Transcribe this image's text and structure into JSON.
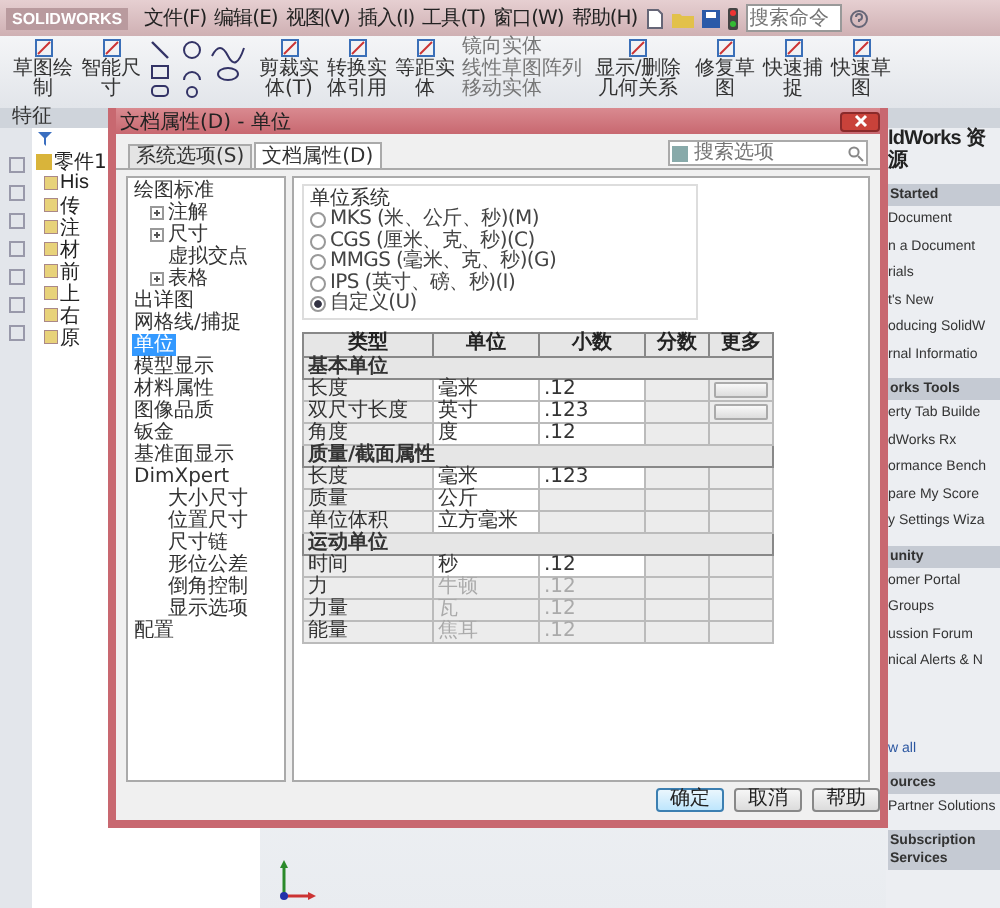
{
  "app": {
    "logo": "SOLIDWORKS",
    "menu": [
      "文件(F)",
      "编辑(E)",
      "视图(V)",
      "插入(I)",
      "工具(T)",
      "窗口(W)",
      "帮助(H)"
    ],
    "search": {
      "placeholder": "搜索命令"
    },
    "ribbon": [
      {
        "label": "草图绘制",
        "kind": "button"
      },
      {
        "label": "智能尺寸",
        "kind": "button"
      },
      {
        "kind": "tools"
      },
      {
        "label": "剪裁实体(T)",
        "kind": "button"
      },
      {
        "label": "转换实体引用",
        "kind": "button"
      },
      {
        "label": "等距实体",
        "kind": "button"
      },
      {
        "kind": "list",
        "items": [
          "镜向实体",
          "线性草图阵列",
          "移动实体"
        ]
      },
      {
        "label": "显示/删除几何关系",
        "kind": "wide"
      },
      {
        "label": "修复草图",
        "kind": "button"
      },
      {
        "label": "快速捕捉",
        "kind": "button"
      },
      {
        "label": "快速草图",
        "kind": "button"
      }
    ],
    "tabs": [
      {
        "label": "特征",
        "selected": false
      }
    ]
  },
  "feature_tree": {
    "root": "零件1",
    "items": [
      "His",
      "传",
      "注",
      "材",
      "前",
      "上",
      "右",
      "原"
    ]
  },
  "dialog": {
    "title": "文档属性(D) - 单位",
    "tabs": [
      {
        "label": "系统选项(S)",
        "selected": false
      },
      {
        "label": "文档属性(D)",
        "selected": true
      }
    ],
    "search": {
      "placeholder": "搜索选项"
    },
    "tree": [
      {
        "label": "绘图标准",
        "selected": false,
        "expanded": true,
        "children": [
          {
            "label": "注解",
            "selected": false,
            "expanded": false
          },
          {
            "label": "尺寸",
            "selected": false,
            "expanded": false
          },
          {
            "label": "虚拟交点",
            "selected": false
          },
          {
            "label": "表格",
            "selected": false,
            "expanded": false
          }
        ]
      },
      {
        "label": "出详图",
        "selected": false
      },
      {
        "label": "网格线/捕捉",
        "selected": false
      },
      {
        "label": "单位",
        "selected": true
      },
      {
        "label": "模型显示",
        "selected": false
      },
      {
        "label": "材料属性",
        "selected": false
      },
      {
        "label": "图像品质",
        "selected": false
      },
      {
        "label": "钣金",
        "selected": false
      },
      {
        "label": "基准面显示",
        "selected": false
      },
      {
        "label": "DimXpert",
        "selected": false,
        "expanded": true,
        "children": [
          {
            "label": "大小尺寸",
            "selected": false
          },
          {
            "label": "位置尺寸",
            "selected": false
          },
          {
            "label": "尺寸链",
            "selected": false
          },
          {
            "label": "形位公差",
            "selected": false
          },
          {
            "label": "倒角控制",
            "selected": false
          },
          {
            "label": "显示选项",
            "selected": false
          }
        ]
      },
      {
        "label": "配置",
        "selected": false
      }
    ],
    "unit_system": {
      "title": "单位系统",
      "options": [
        {
          "label": "MKS (米、公斤、秒)(M)",
          "selected": false
        },
        {
          "label": "CGS (厘米、克、秒)(C)",
          "selected": false
        },
        {
          "label": "MMGS (毫米、克、秒)(G)",
          "selected": false
        },
        {
          "label": "IPS (英寸、磅、秒)(I)",
          "selected": false
        },
        {
          "label": "自定义(U)",
          "selected": true
        }
      ]
    },
    "table": {
      "columns": [
        "类型",
        "单位",
        "小数",
        "分数",
        "更多"
      ],
      "rows": [
        {
          "kind": "section",
          "label": "基本单位"
        },
        {
          "kind": "row",
          "type": "长度",
          "unit": "毫米",
          "decimal": ".12",
          "disabled": false,
          "more": true
        },
        {
          "kind": "row",
          "type": "双尺寸长度",
          "unit": "英寸",
          "decimal": ".123",
          "disabled": false,
          "more": true
        },
        {
          "kind": "row",
          "type": "角度",
          "unit": "度",
          "decimal": ".12",
          "disabled": false,
          "more": false
        },
        {
          "kind": "section",
          "label": "质量/截面属性"
        },
        {
          "kind": "row",
          "type": "长度",
          "unit": "毫米",
          "decimal": ".123",
          "disabled": false,
          "more": false
        },
        {
          "kind": "row",
          "type": "质量",
          "unit": "公斤",
          "disabled": false,
          "more": false
        },
        {
          "kind": "row",
          "type": "单位体积",
          "unit": "立方毫米",
          "disabled": false,
          "more": false
        },
        {
          "kind": "section",
          "label": "运动单位"
        },
        {
          "kind": "row",
          "type": "时间",
          "unit": "秒",
          "decimal": ".12",
          "disabled": false,
          "more": false
        },
        {
          "kind": "row",
          "type": "力",
          "unit": "牛顿",
          "decimal": ".12",
          "disabled": true,
          "more": false
        },
        {
          "kind": "row",
          "type": "力量",
          "unit": "瓦",
          "decimal": ".12",
          "disabled": true,
          "more": false
        },
        {
          "kind": "row",
          "type": "能量",
          "unit": "焦耳",
          "decimal": ".12",
          "disabled": true,
          "more": false
        }
      ]
    },
    "buttons": [
      {
        "label": "确定",
        "kind": "default"
      },
      {
        "label": "取消",
        "kind": "normal"
      },
      {
        "label": "帮助",
        "kind": "normal"
      }
    ]
  },
  "task_pane": {
    "title": "ldWorks 资源",
    "items": [
      {
        "kind": "header",
        "text": "Started"
      },
      {
        "kind": "item",
        "text": "Document"
      },
      {
        "kind": "item",
        "text": "n a Document"
      },
      {
        "kind": "item",
        "text": "rials"
      },
      {
        "kind": "item",
        "text": "t's New"
      },
      {
        "kind": "item",
        "text": "oducing SolidW"
      },
      {
        "kind": "item",
        "text": "rnal Informatio"
      },
      {
        "kind": "header",
        "text": "orks Tools"
      },
      {
        "kind": "item",
        "text": "erty Tab Builde"
      },
      {
        "kind": "item",
        "text": "dWorks Rx"
      },
      {
        "kind": "item",
        "text": "ormance Bench"
      },
      {
        "kind": "item",
        "text": "pare My Score"
      },
      {
        "kind": "item",
        "text": "y Settings Wiza"
      },
      {
        "kind": "header",
        "text": "unity"
      },
      {
        "kind": "item",
        "text": "omer Portal"
      },
      {
        "kind": "item",
        "text": "Groups"
      },
      {
        "kind": "item",
        "text": "ussion Forum"
      },
      {
        "kind": "item",
        "text": "nical Alerts & N"
      },
      {
        "kind": "link",
        "text": "w all"
      },
      {
        "kind": "header",
        "text": "ources"
      },
      {
        "kind": "item",
        "text": "Partner Solutions"
      },
      {
        "kind": "header",
        "text": "Subscription Services"
      }
    ]
  }
}
